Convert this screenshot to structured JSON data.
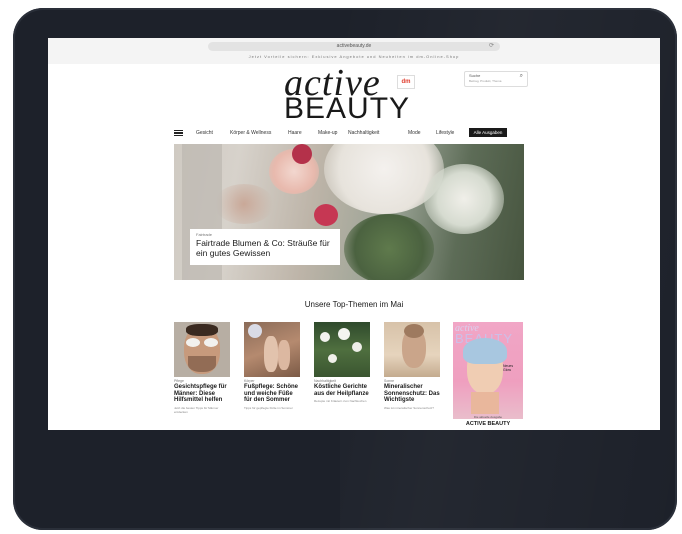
{
  "browser": {
    "url": "activebeauty.de",
    "promo": "Jetzt Vorteile sichern: Exklusive Angebote und Neuheiten im dm-Online-Shop"
  },
  "brand": {
    "logo_top": "active",
    "logo_bottom": "BEAUTY",
    "partner_logo_a": "d",
    "partner_logo_b": "m"
  },
  "search": {
    "label": "Suche",
    "sub": "Beitrag, Produkt, Thema"
  },
  "nav": {
    "items": [
      "Gesicht",
      "Körper & Wellness",
      "Haare",
      "Make-up",
      "Nachhaltigkeit",
      "Mode",
      "Lifestyle"
    ],
    "cta": "Alle Ausgaben"
  },
  "hero": {
    "kicker": "Fairtrade",
    "title": "Fairtrade Blumen & Co: Sträuße für ein gutes Gewissen"
  },
  "section": {
    "title": "Unsere Top-Themen im Mai"
  },
  "cards": [
    {
      "kicker": "Pflege",
      "title": "Gesichtspflege für Männer: Diese Hilfsmittel helfen",
      "meta": "Jetzt die besten Tipps für Männer entdecken"
    },
    {
      "kicker": "Körper",
      "title": "Fußpflege: Schöne und weiche Füße für den Sommer",
      "meta": "Tipps für gepflegte Füße im Sommer"
    },
    {
      "kicker": "Nachhaltigkeit",
      "title": "Köstliche Gerichte aus der Heilpflanze",
      "meta": "Rezepte mit Kräutern zum Nachkochen"
    },
    {
      "kicker": "Sonne",
      "title": "Mineralischer Sonnenschutz: Das Wichtigste",
      "meta": "Was ist mineralischer Sonnenschutz?"
    }
  ],
  "magazine": {
    "logo_top": "active",
    "logo_bottom": "BEAUTY",
    "cover_text": "Neues Glow",
    "kicker": "Die aktuelle Ausgabe",
    "title": "ACTIVE BEAUTY"
  },
  "colors": {
    "device": "#1d212a",
    "accent": "#1a1a1a",
    "magazine_pink": "#f1a6c6"
  }
}
